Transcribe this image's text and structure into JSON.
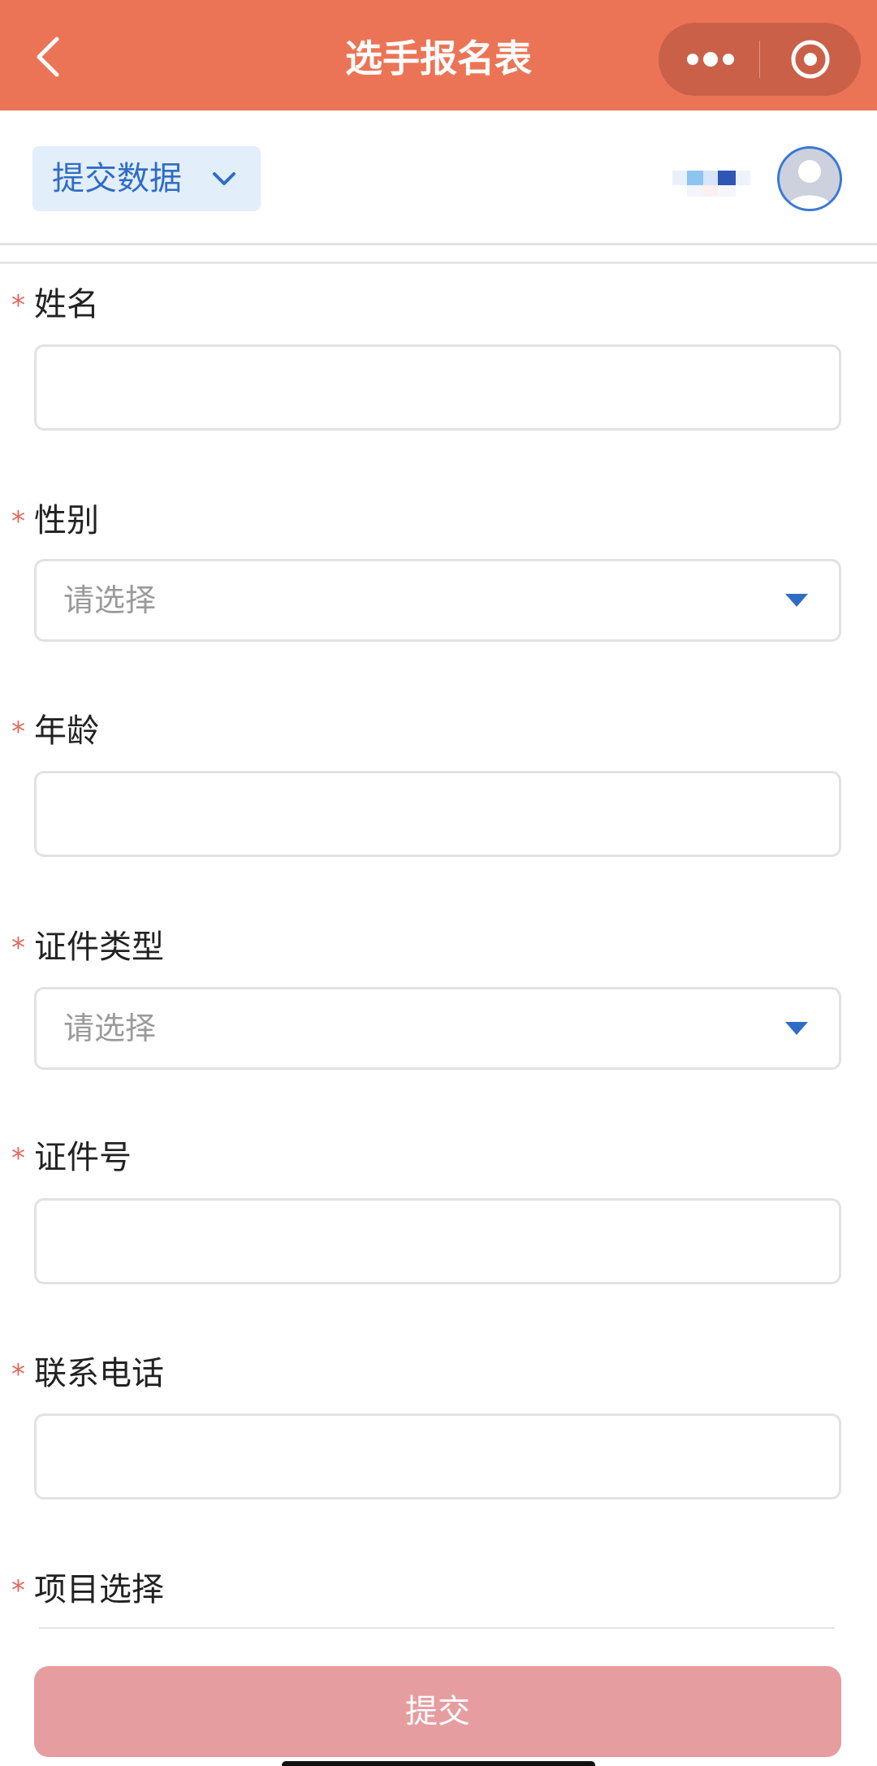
{
  "header": {
    "title": "选手报名表",
    "back_icon": "chevron-left-icon",
    "more_icon": "more-dots-icon",
    "close_icon": "target-circle-icon",
    "color": "#EC7456"
  },
  "toolbar": {
    "submit_data_label": "提交数据",
    "submit_data_icon": "chevron-down-icon",
    "accent": "#2F6DC5"
  },
  "form": {
    "fields": [
      {
        "label": "姓名",
        "required": true,
        "type": "text",
        "value": ""
      },
      {
        "label": "性别",
        "required": true,
        "type": "select",
        "placeholder": "请选择"
      },
      {
        "label": "年龄",
        "required": true,
        "type": "text",
        "value": ""
      },
      {
        "label": "证件类型",
        "required": true,
        "type": "select",
        "placeholder": "请选择"
      },
      {
        "label": "证件号",
        "required": true,
        "type": "text",
        "value": ""
      },
      {
        "label": "联系电话",
        "required": true,
        "type": "text",
        "value": ""
      },
      {
        "label": "项目选择",
        "required": true,
        "type": "options"
      }
    ],
    "required_mark": "*",
    "required_color": "#E26A5C"
  },
  "submit": {
    "label": "提交",
    "color": "#E69DA0"
  }
}
